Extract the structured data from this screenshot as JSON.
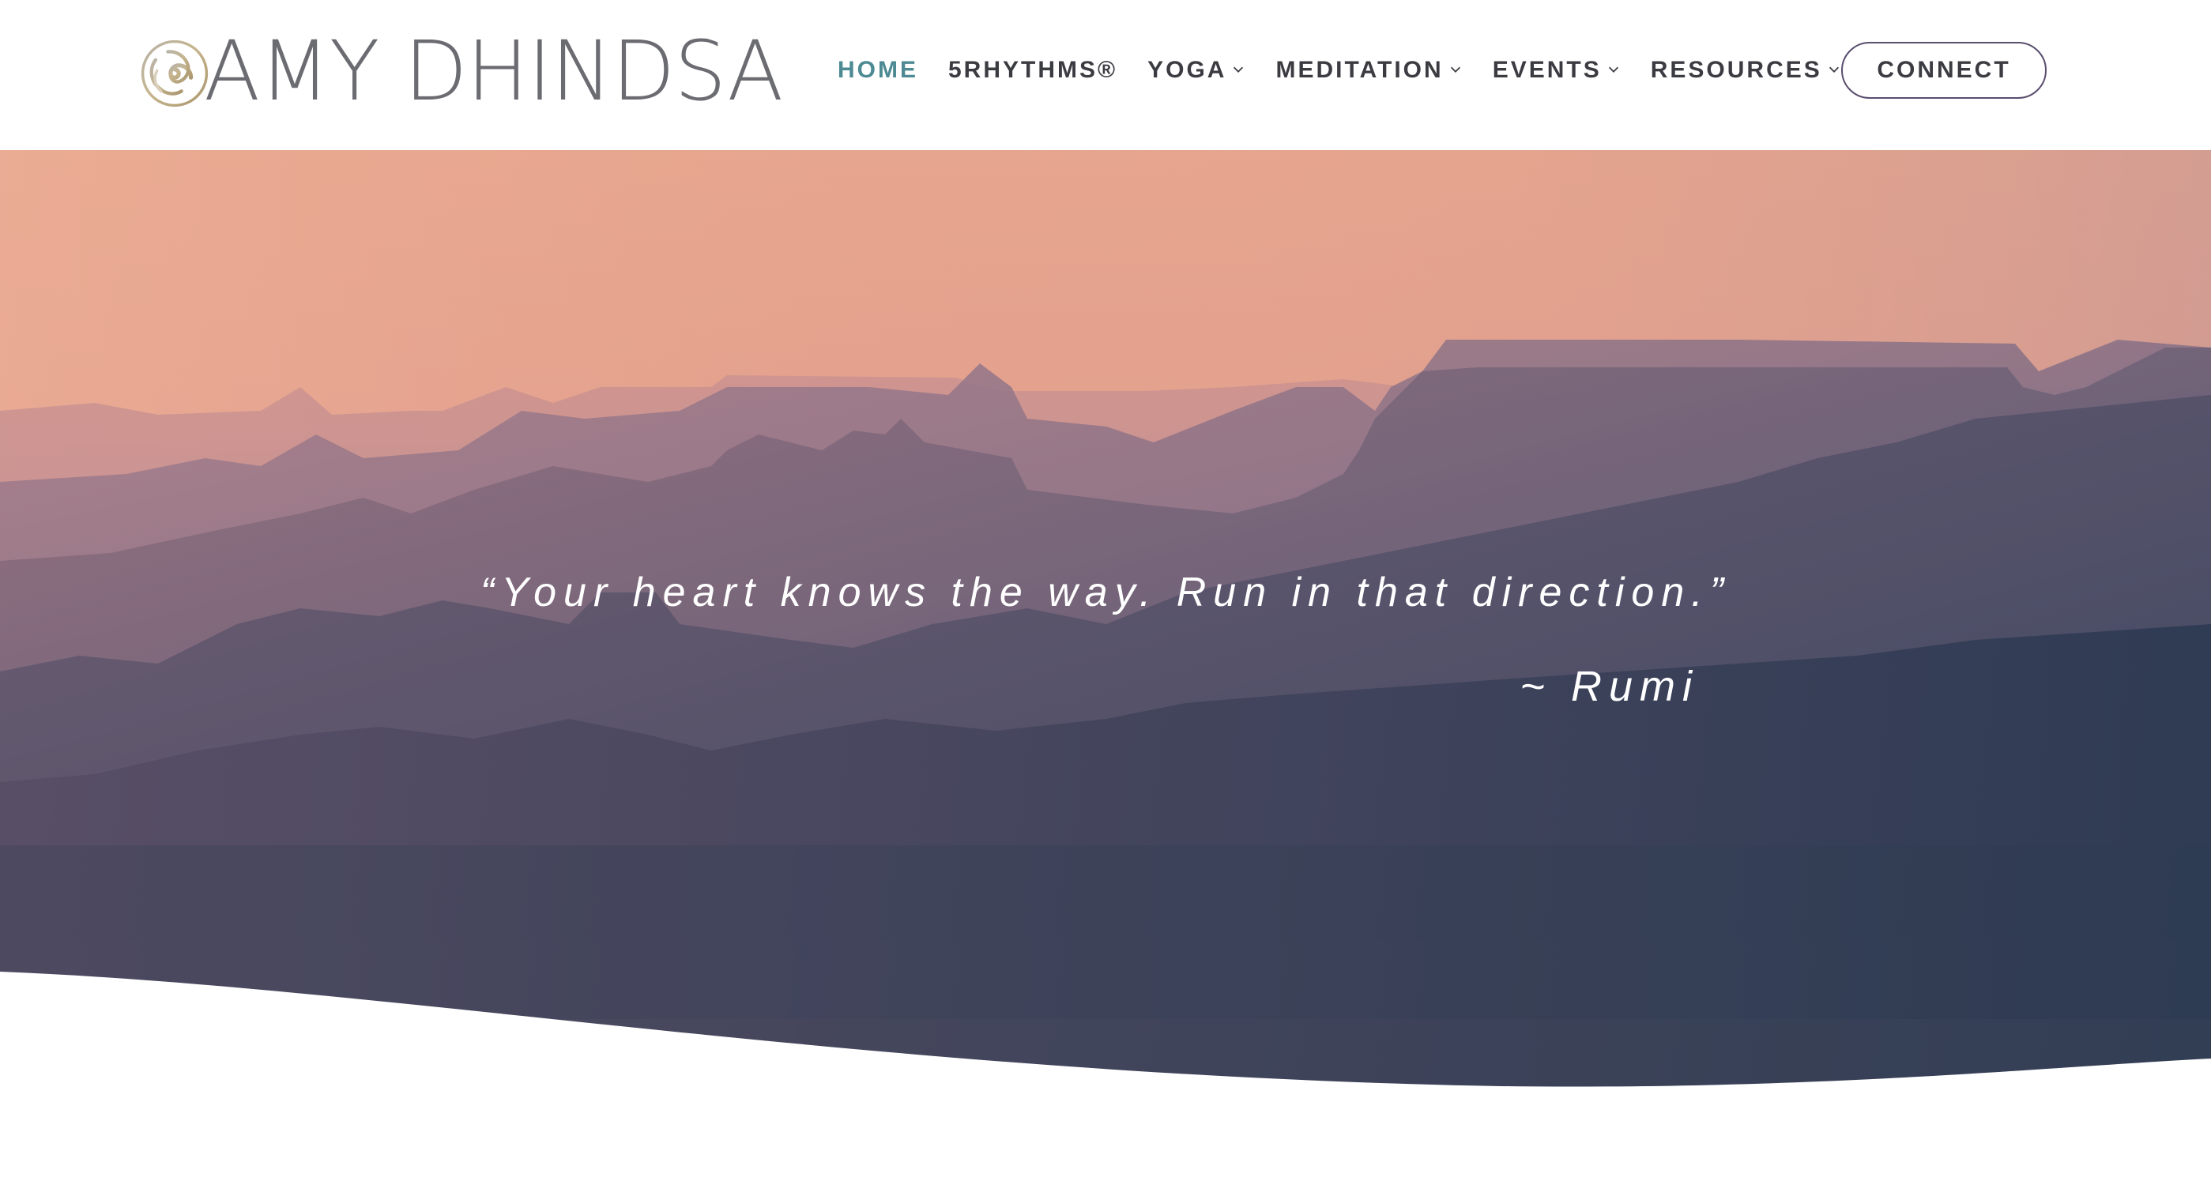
{
  "header": {
    "logo_text": "AMY DHINDSA",
    "logo_icon": "spiral-swirl-icon"
  },
  "nav": {
    "items": [
      {
        "label": "HOME",
        "active": true,
        "has_dropdown": false
      },
      {
        "label": "5RHYTHMS®",
        "active": false,
        "has_dropdown": false
      },
      {
        "label": "YOGA",
        "active": false,
        "has_dropdown": true
      },
      {
        "label": "MEDITATION",
        "active": false,
        "has_dropdown": true
      },
      {
        "label": "EVENTS",
        "active": false,
        "has_dropdown": true
      },
      {
        "label": "RESOURCES",
        "active": false,
        "has_dropdown": true
      }
    ],
    "connect_label": "CONNECT"
  },
  "hero": {
    "quote": "“Your heart knows the way. Run in that direction.”",
    "attribution": "~ Rumi"
  },
  "colors": {
    "active_nav": "#4d8a93",
    "nav_text": "#3b3b42",
    "logo_text": "#6b6b72",
    "connect_border": "#5a4d6e",
    "sky_top": "#e8aa90",
    "canyon_dark": "#2c3a50"
  }
}
